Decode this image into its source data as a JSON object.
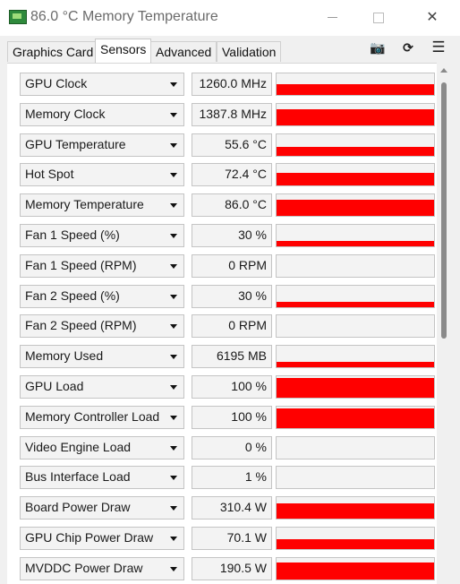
{
  "window": {
    "title": "86.0 °C Memory Temperature",
    "app_icon": "gpu-card-icon",
    "minimize": "minimize-icon",
    "maximize": "maximize-icon",
    "close": "✕"
  },
  "tabs": [
    {
      "label": "Graphics Card",
      "active": false
    },
    {
      "label": "Sensors",
      "active": true
    },
    {
      "label": "Advanced",
      "active": false
    },
    {
      "label": "Validation",
      "active": false
    }
  ],
  "toolbar": {
    "screenshot": "📷",
    "refresh": "⟳",
    "menu": "☰"
  },
  "accent_color": "#ff0000",
  "sensors": [
    {
      "name": "GPU Clock",
      "value": "1260.0 MHz",
      "level": 0.55
    },
    {
      "name": "Memory Clock",
      "value": "1387.8 MHz",
      "level": 0.82
    },
    {
      "name": "GPU Temperature",
      "value": "55.6 °C",
      "level": 0.45
    },
    {
      "name": "Hot Spot",
      "value": "72.4 °C",
      "level": 0.62
    },
    {
      "name": "Memory Temperature",
      "value": "86.0 °C",
      "level": 0.82
    },
    {
      "name": "Fan 1 Speed (%)",
      "value": "30 %",
      "level": 0.28
    },
    {
      "name": "Fan 1 Speed (RPM)",
      "value": "0 RPM",
      "level": 0
    },
    {
      "name": "Fan 2 Speed (%)",
      "value": "30 %",
      "level": 0.28
    },
    {
      "name": "Fan 2 Speed (RPM)",
      "value": "0 RPM",
      "level": 0
    },
    {
      "name": "Memory Used",
      "value": "6195 MB",
      "level": 0.25
    },
    {
      "name": "GPU Load",
      "value": "100 %",
      "level": 1.0
    },
    {
      "name": "Memory Controller Load",
      "value": "100 %",
      "level": 1.0
    },
    {
      "name": "Video Engine Load",
      "value": "0 %",
      "level": 0
    },
    {
      "name": "Bus Interface Load",
      "value": "1 %",
      "level": 0
    },
    {
      "name": "Board Power Draw",
      "value": "310.4 W",
      "level": 0.78
    },
    {
      "name": "GPU Chip Power Draw",
      "value": "70.1 W",
      "level": 0.5
    },
    {
      "name": "MVDDC Power Draw",
      "value": "190.5 W",
      "level": 0.88
    }
  ]
}
